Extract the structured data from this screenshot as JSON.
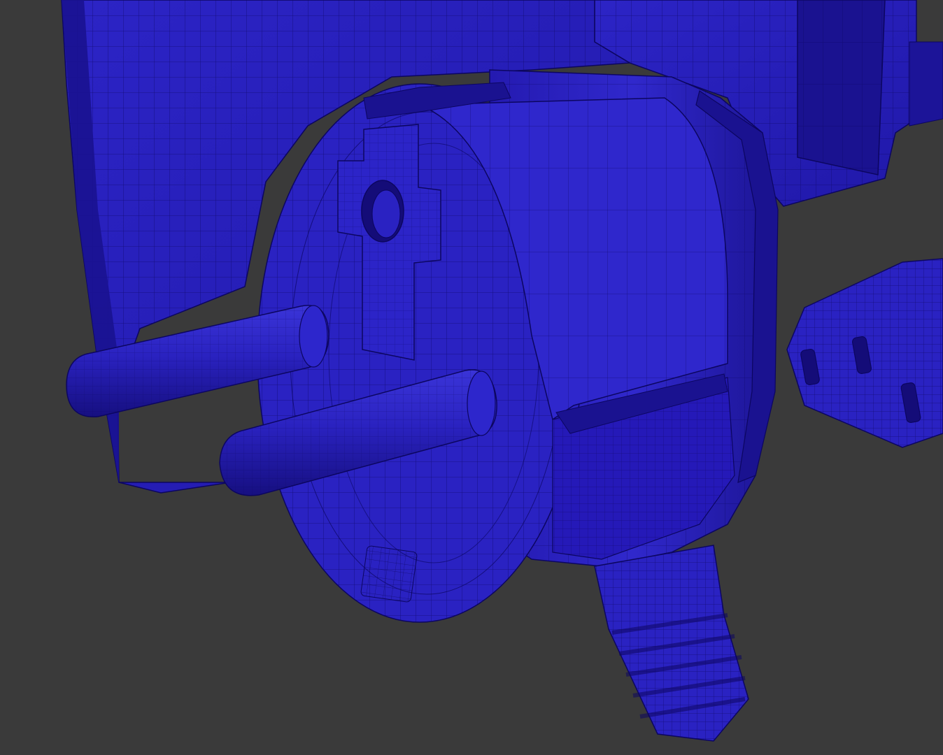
{
  "viewport": {
    "background": "#3a3a3a",
    "material_color": "#2a22c2",
    "material_shadow": "#1a1290",
    "material_highlight": "#4a44e0",
    "wire_color": "#0c0660"
  },
  "objects": [
    "back-housing",
    "rear-bracket",
    "plug-body",
    "earth-clip",
    "pin-left",
    "pin-right",
    "cable-strain-relief",
    "iec-connector"
  ]
}
